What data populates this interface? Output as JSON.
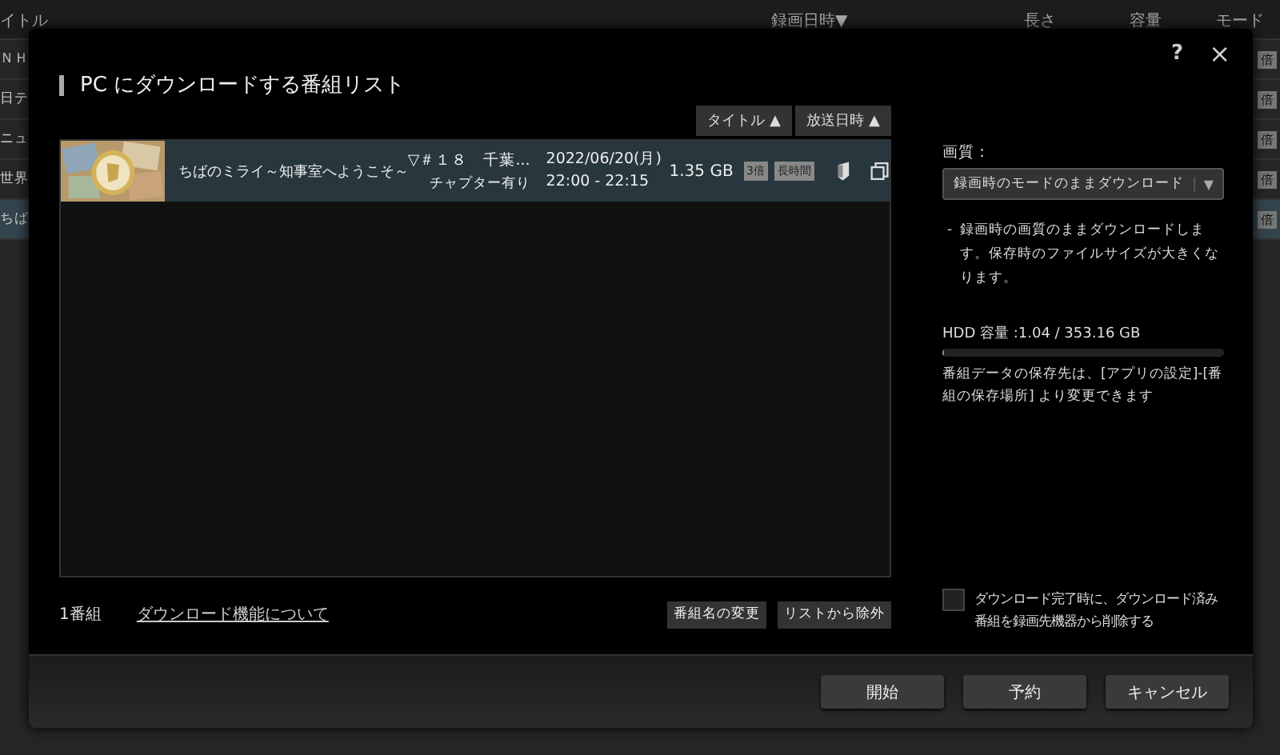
{
  "background_list": {
    "columns": [
      {
        "label": "イトル"
      },
      {
        "label": "録画日時",
        "sort": "▼"
      },
      {
        "label": "長さ"
      },
      {
        "label": "容量"
      },
      {
        "label": "モード"
      }
    ],
    "rows": [
      {
        "title": "ＮＨ",
        "selected": false,
        "badge": "倍"
      },
      {
        "title": "日テ",
        "selected": false,
        "badge": "倍"
      },
      {
        "title": "ニュ",
        "selected": false,
        "badge": "倍"
      },
      {
        "title": "世界",
        "selected": false,
        "badge": "倍"
      },
      {
        "title": "ちば",
        "selected": true,
        "badge": "倍"
      }
    ]
  },
  "dialog": {
    "title": "PC にダウンロードする番組リスト",
    "help": "?",
    "close": "×",
    "sort_buttons": [
      {
        "label": "タイトル",
        "arrow": "▲"
      },
      {
        "label": "放送日時",
        "arrow": "▲"
      }
    ],
    "programs": [
      {
        "selected": true,
        "title": "ちばのミライ～知事室へようこそ～",
        "episode": "▽＃１８　千葉...",
        "chapter": "チャプター有り",
        "date": "2022/06/20(月)",
        "time": "22:00 - 22:15",
        "size": "1.35 GB",
        "badges": [
          "3倍",
          "長時間"
        ]
      }
    ],
    "quality": {
      "label": "画質：",
      "value": "録画時のモードのままダウンロード",
      "caret": "▼",
      "bullet": "-",
      "description": "録画時の画質のままダウンロードします。保存時のファイルサイズが大きくなります。"
    },
    "hdd": {
      "label": "HDD 容量 :1.04 / 353.16 GB",
      "level": 0.003
    },
    "storage_note": "番組データの保存先は、[アプリの設定]-[番組の保存場所] より変更できます",
    "count": "1番組",
    "help_link": "ダウンロード機能について",
    "list_buttons": [
      "番組名の変更",
      "リストから除外"
    ],
    "delete_after": {
      "checked": false,
      "label": "ダウンロード完了時に、ダウンロード済み番組を録画先機器から削除する"
    },
    "buttons": [
      "開始",
      "予約",
      "キャンセル"
    ]
  }
}
